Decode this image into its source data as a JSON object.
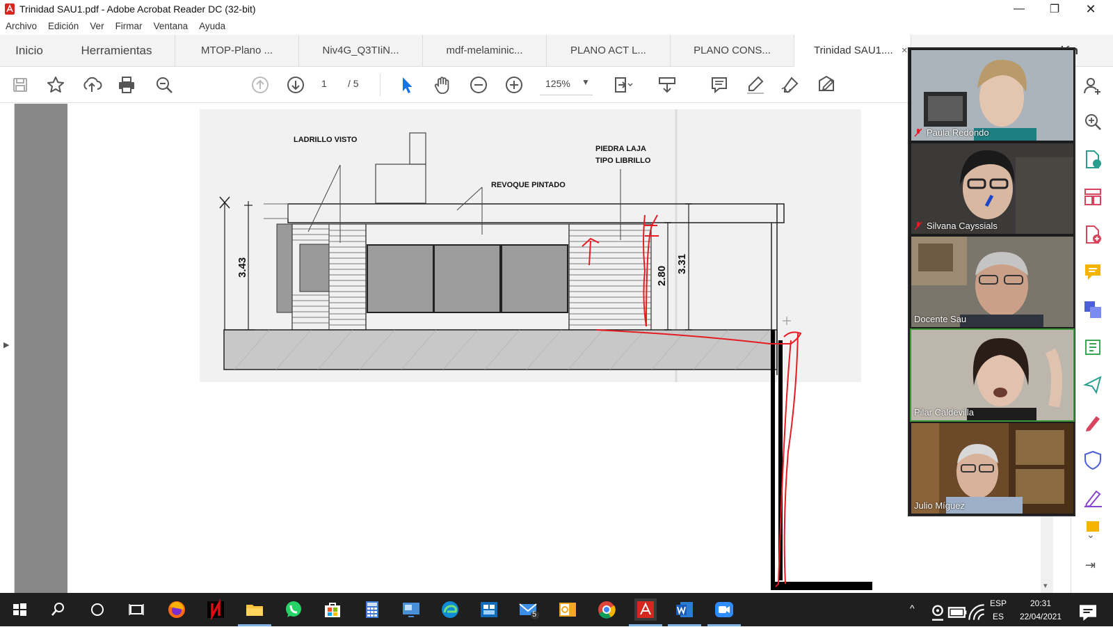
{
  "window": {
    "title": "Trinidad SAU1.pdf - Adobe Acrobat Reader DC (32-bit)",
    "controls": {
      "minimize": "—",
      "restore": "❐",
      "close": "✕"
    }
  },
  "menu": [
    "Archivo",
    "Edición",
    "Ver",
    "Firmar",
    "Ventana",
    "Ayuda"
  ],
  "tabs": [
    {
      "label": "Inicio"
    },
    {
      "label": "Herramientas"
    },
    {
      "label": "MTOP-Plano ..."
    },
    {
      "label": "Niv4G_Q3TIiN..."
    },
    {
      "label": "mdf-melaminic..."
    },
    {
      "label": "PLANO ACT L..."
    },
    {
      "label": "PLANO CONS..."
    },
    {
      "label": "Trinidad SAU1...."
    }
  ],
  "tab_close": "×",
  "signin_partial": "Iniciar sesión",
  "toolbar": {
    "page_current": "1",
    "page_total": "/ 5",
    "zoom": "125%",
    "icons": [
      "save-icon",
      "star-icon",
      "upload-icon",
      "print-icon",
      "search-zoom-icon",
      "page-up-icon",
      "page-down-icon",
      "select-arrow-icon",
      "hand-icon",
      "zoom-out-icon",
      "zoom-in-icon",
      "fit-page-icon",
      "scroll-mode-icon",
      "comment-icon",
      "highlight-icon",
      "sign-icon",
      "fill-sign-icon"
    ]
  },
  "drawing": {
    "labels": {
      "ladrillo": "LADRILLO VISTO",
      "revoque": "REVOQUE PINTADO",
      "piedra1": "PIEDRA LAJA",
      "piedra2": "TIPO LIBRILLO",
      "dim1": "3.43",
      "dim2": "2.80",
      "dim3": "3.31"
    }
  },
  "participants": [
    {
      "name": "Paula Redondo",
      "muted": true,
      "bg": "#9aa8b0"
    },
    {
      "name": "Silvana Cayssials",
      "muted": true,
      "bg": "#3a3a3a"
    },
    {
      "name": "Docente Sau",
      "muted": false,
      "bg": "#6e6a60"
    },
    {
      "name": "Pilar Caldevilla",
      "muted": false,
      "bg": "#b8b0a6"
    },
    {
      "name": "Julio Míguez",
      "muted": false,
      "bg": "#7a5a35"
    }
  ],
  "tray": {
    "lang1": "ESP",
    "lang2": "ES",
    "time": "20:31",
    "date": "22/04/2021",
    "mail_badge": "5"
  },
  "colors": {
    "accent": "#1473e6",
    "markup_red": "#e51c23",
    "taskbar": "#1f1f1f"
  }
}
